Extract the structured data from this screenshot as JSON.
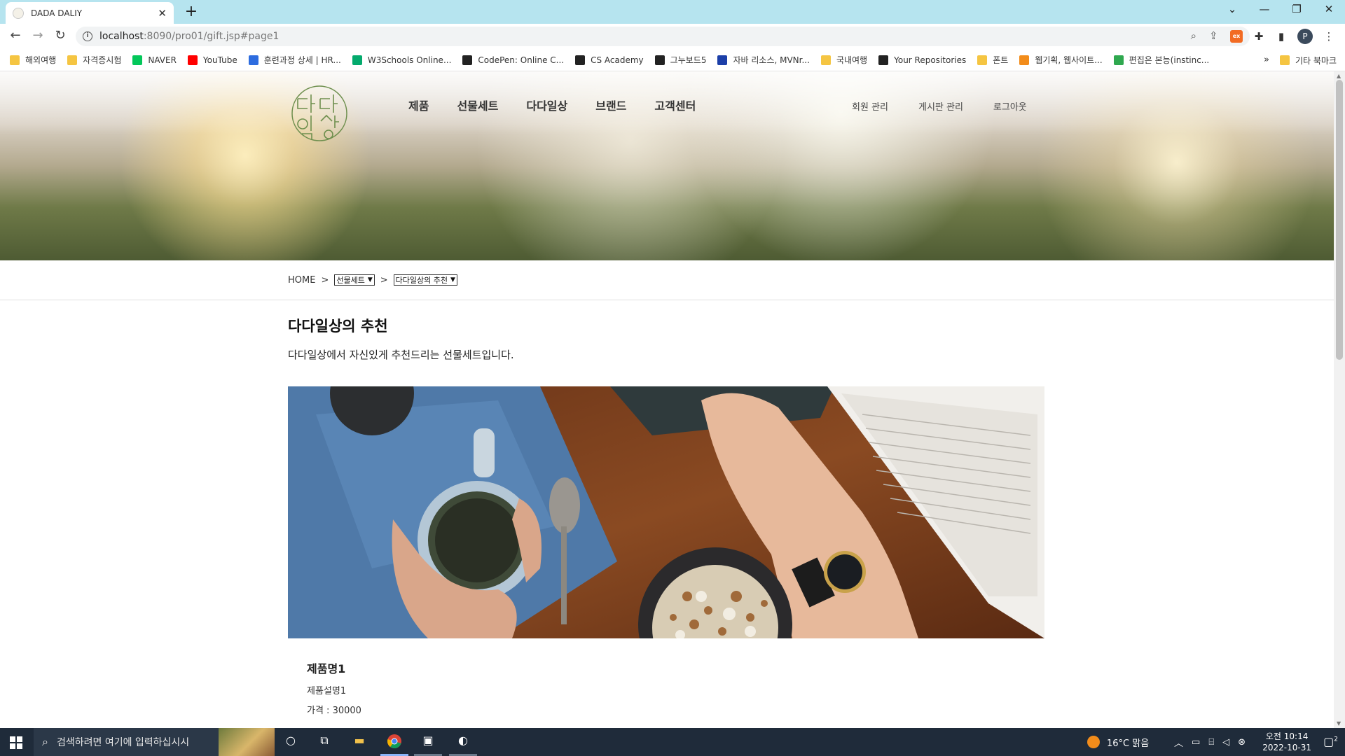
{
  "browser": {
    "tab_title": "DADA DALIY",
    "tab_close": "✕",
    "new_tab": "+",
    "url_host": "localhost",
    "url_path": ":8090/pro01/gift.jsp#page1",
    "window_controls": [
      "⌄",
      "—",
      "❐",
      "✕"
    ],
    "bookmarks": [
      {
        "label": "해외여행",
        "icon": "folder",
        "color": "#f5c542"
      },
      {
        "label": "자격증시험",
        "icon": "folder",
        "color": "#f5c542"
      },
      {
        "label": "NAVER",
        "icon": "naver",
        "color": "#03c75a"
      },
      {
        "label": "YouTube",
        "icon": "youtube",
        "color": "#ff0000"
      },
      {
        "label": "훈련과정 상세 | HR...",
        "icon": "hrd",
        "color": "#2d6cdf"
      },
      {
        "label": "W3Schools Online...",
        "icon": "w3schools",
        "color": "#04aa6d"
      },
      {
        "label": "CodePen: Online C...",
        "icon": "codepen",
        "color": "#222222"
      },
      {
        "label": "CS Academy",
        "icon": "cs-academy",
        "color": "#222222"
      },
      {
        "label": "그누보드5",
        "icon": "gnuboard",
        "color": "#222222"
      },
      {
        "label": "자바 리소스, MVNr...",
        "icon": "mvn",
        "color": "#1c3fa8"
      },
      {
        "label": "국내여행",
        "icon": "folder",
        "color": "#f5c542"
      },
      {
        "label": "Your Repositories",
        "icon": "github",
        "color": "#222222"
      },
      {
        "label": "폰트",
        "icon": "folder",
        "color": "#f5c542"
      },
      {
        "label": "웹기획, 웹사이트...",
        "icon": "webplan",
        "color": "#f28c1b"
      },
      {
        "label": "편집은 본능(instinc...",
        "icon": "edit",
        "color": "#2fa84f"
      }
    ],
    "bookmarks_more": "»",
    "other_bookmarks": "기타 북마크",
    "profile_letter": "P"
  },
  "site": {
    "logo_text": "다다일상",
    "nav": [
      "제품",
      "선물세트",
      "다다일상",
      "브랜드",
      "고객센터"
    ],
    "util": [
      "회원 관리",
      "게시판 관리",
      "로그아웃"
    ]
  },
  "breadcrumb": {
    "home": "HOME",
    "separator": ">",
    "level1": "선물세트",
    "level2": "다다일상의 추천"
  },
  "main": {
    "title": "다다일상의 추천",
    "description": "다다일상에서 자신있게 추천드리는 선물세트입니다.",
    "product": {
      "name": "제품명1",
      "description": "제품설명1",
      "price": "가격 : 30000"
    }
  },
  "taskbar": {
    "search_placeholder": "검색하려면 여기에 입력하십시시",
    "weather": "16°C  맑음",
    "time": "오전 10:14",
    "date": "2022-10-31",
    "notifications": "2"
  }
}
